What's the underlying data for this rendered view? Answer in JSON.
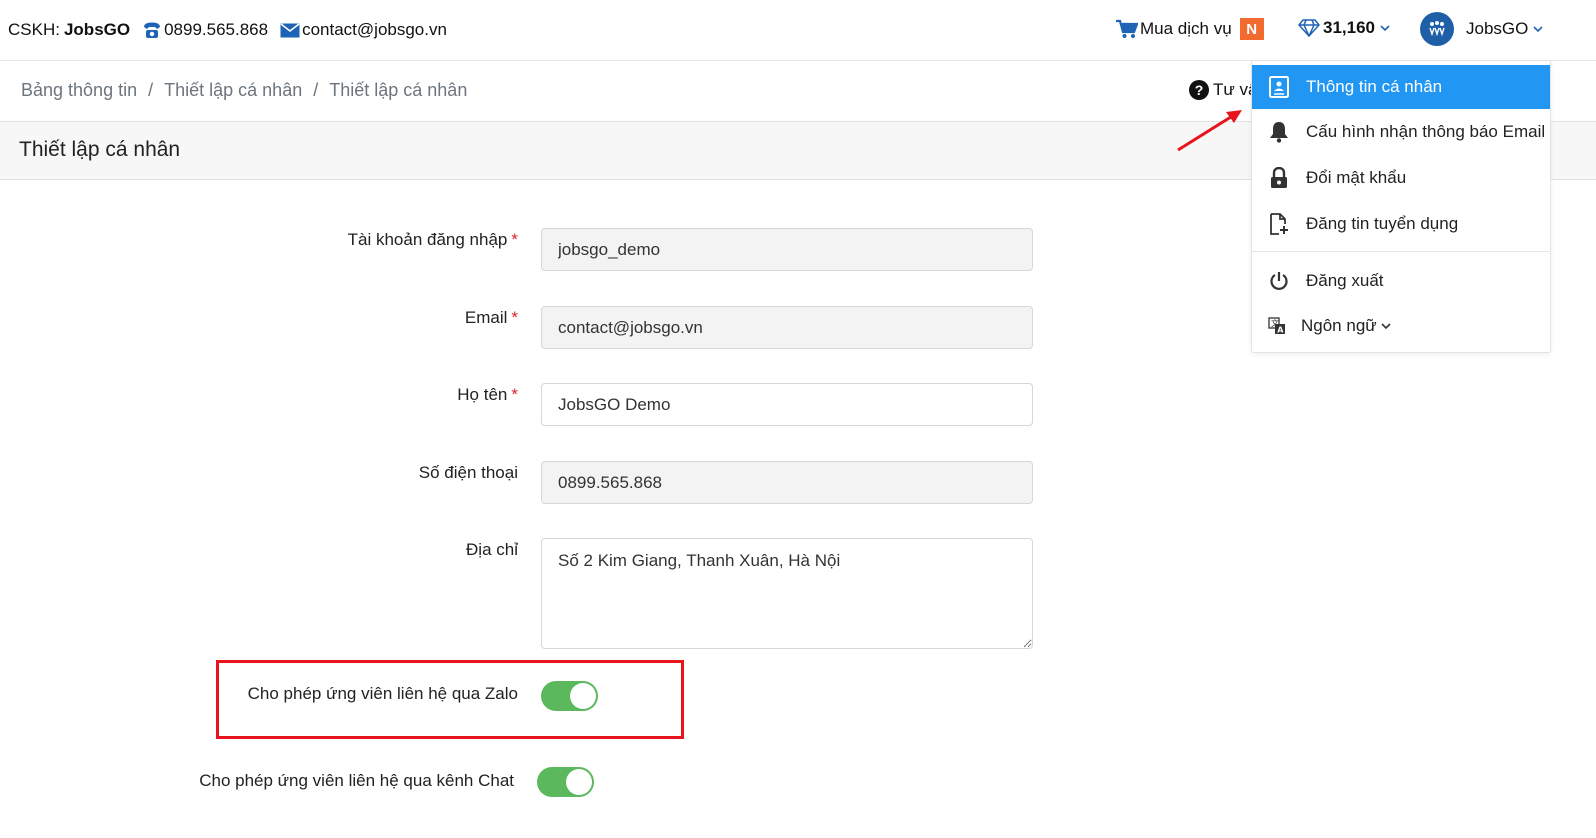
{
  "topbar": {
    "cskh_label": "CSKH:",
    "cskh_name": "JobsGO",
    "phone": "0899.565.868",
    "email": "contact@jobsgo.vn",
    "buy_service": "Mua dịch vụ",
    "buy_badge": "N",
    "points": "31,160",
    "user_name": "JobsGO"
  },
  "breadcrumb": {
    "items": [
      "Bảng thông tin",
      "Thiết lập cá nhân",
      "Thiết lập cá nhân"
    ],
    "separator": "/"
  },
  "help_label": "Tư vấ",
  "page_title": "Thiết lập cá nhân",
  "form": {
    "username": {
      "label": "Tài khoản đăng nhập",
      "required": "*",
      "value": "jobsgo_demo"
    },
    "email": {
      "label": "Email",
      "required": "*",
      "value": "contact@jobsgo.vn"
    },
    "fullname": {
      "label": "Họ tên",
      "required": "*",
      "value": "JobsGO Demo"
    },
    "phone": {
      "label": "Số điện thoại",
      "value": "0899.565.868"
    },
    "address": {
      "label": "Địa chỉ",
      "value": "Số 2 Kim Giang, Thanh Xuân, Hà Nội"
    },
    "zalo_toggle": {
      "label": "Cho phép ứng viên liên hệ qua Zalo",
      "on": true
    },
    "chat_toggle": {
      "label": "Cho phép ứng viên liên hệ qua kênh Chat",
      "on": true
    }
  },
  "dropdown": {
    "items": [
      {
        "label": "Thông tin cá nhân",
        "icon": "profile-icon",
        "active": true
      },
      {
        "label": "Cấu hình nhận thông báo Email",
        "icon": "bell-icon"
      },
      {
        "label": "Đổi mật khẩu",
        "icon": "lock-icon"
      },
      {
        "label": "Đăng tin tuyển dụng",
        "icon": "new-document-icon"
      },
      {
        "label": "Đăng xuất",
        "icon": "power-icon"
      },
      {
        "label": "Ngôn ngữ",
        "icon": "translate-icon"
      }
    ]
  },
  "colors": {
    "accent": "#2196f3",
    "toggle_on": "#5cb85c",
    "highlight": "#e8141c",
    "badge": "#f26a2d",
    "required": "#d9232d"
  }
}
